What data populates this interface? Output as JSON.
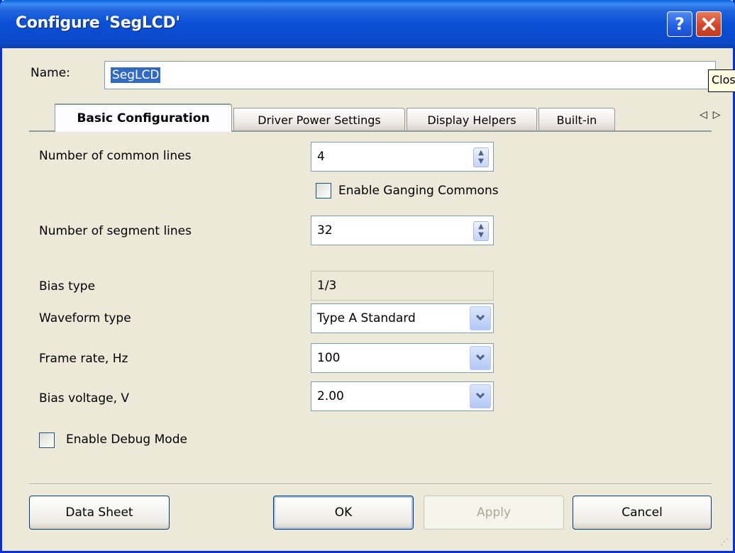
{
  "window": {
    "title": "Configure 'SegLCD'",
    "help_glyph": "?",
    "close_glyph": "✕"
  },
  "name": {
    "label": "Name:",
    "value": "SegLCD"
  },
  "tooltip": {
    "text": "Close"
  },
  "tabs": [
    {
      "label": "Basic Configuration",
      "active": true
    },
    {
      "label": "Driver Power Settings",
      "active": false
    },
    {
      "label": "Display Helpers",
      "active": false
    },
    {
      "label": "Built-in",
      "active": false
    }
  ],
  "tab_scroll": {
    "left": "◁",
    "right": "▷"
  },
  "fields": {
    "common_lines": {
      "label": "Number of common lines",
      "value": "4"
    },
    "ganging": {
      "label": "Enable Ganging Commons",
      "checked": false
    },
    "segment_lines": {
      "label": "Number of segment lines",
      "value": "32"
    },
    "bias_type": {
      "label": "Bias type",
      "value": "1/3"
    },
    "waveform": {
      "label": "Waveform type",
      "value": "Type A Standard"
    },
    "frame_rate": {
      "label": "Frame rate, Hz",
      "value": "100"
    },
    "bias_voltage": {
      "label": "Bias voltage, V",
      "value": "2.00"
    },
    "debug": {
      "label": "Enable Debug Mode",
      "checked": false
    }
  },
  "buttons": {
    "datasheet": "Data Sheet",
    "ok": "OK",
    "apply": "Apply",
    "cancel": "Cancel"
  },
  "icons": {
    "spin_up": "▲",
    "spin_down": "▼",
    "combo_arrow": "▾"
  },
  "colors": {
    "titlebar": "#0a4bd0",
    "selection": "#316ac5",
    "close": "#d6462a"
  }
}
